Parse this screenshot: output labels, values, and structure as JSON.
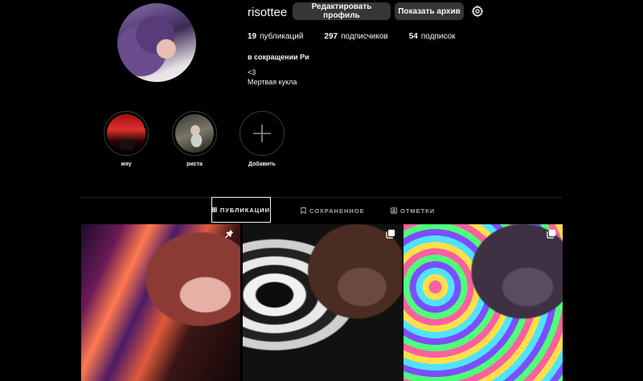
{
  "profile": {
    "username": "risottee",
    "edit_button": "Редактировать профиль",
    "archive_button": "Показать архив",
    "settings_icon": "gear-icon",
    "stats": {
      "posts_count": "19",
      "posts_label": "публикаций",
      "followers_count": "297",
      "followers_label": "подписчиков",
      "following_count": "54",
      "following_label": "подписок"
    },
    "full_name": "в сокращении Ри",
    "bio": [
      "<3",
      "Мертвая кукла"
    ]
  },
  "highlights": [
    {
      "label": "мяу"
    },
    {
      "label": "риста"
    },
    {
      "label": "Добавить",
      "icon": "plus-icon"
    }
  ],
  "tabs": [
    {
      "label": "ПУБЛИКАЦИИ",
      "icon": "grid-icon",
      "active": true
    },
    {
      "label": "СОХРАНЕННОЕ",
      "icon": "bookmark-icon",
      "active": false
    },
    {
      "label": "ОТМЕТКИ",
      "icon": "tag-icon",
      "active": false
    }
  ],
  "posts": [
    {
      "icon": "pin-icon"
    },
    {
      "icon": "carousel-icon"
    },
    {
      "icon": "carousel-icon"
    }
  ],
  "colors": {
    "background": "#000000",
    "button": "#363636",
    "text": "#f5f5f5",
    "muted_text": "#a8a8a8",
    "divider": "#262626"
  }
}
